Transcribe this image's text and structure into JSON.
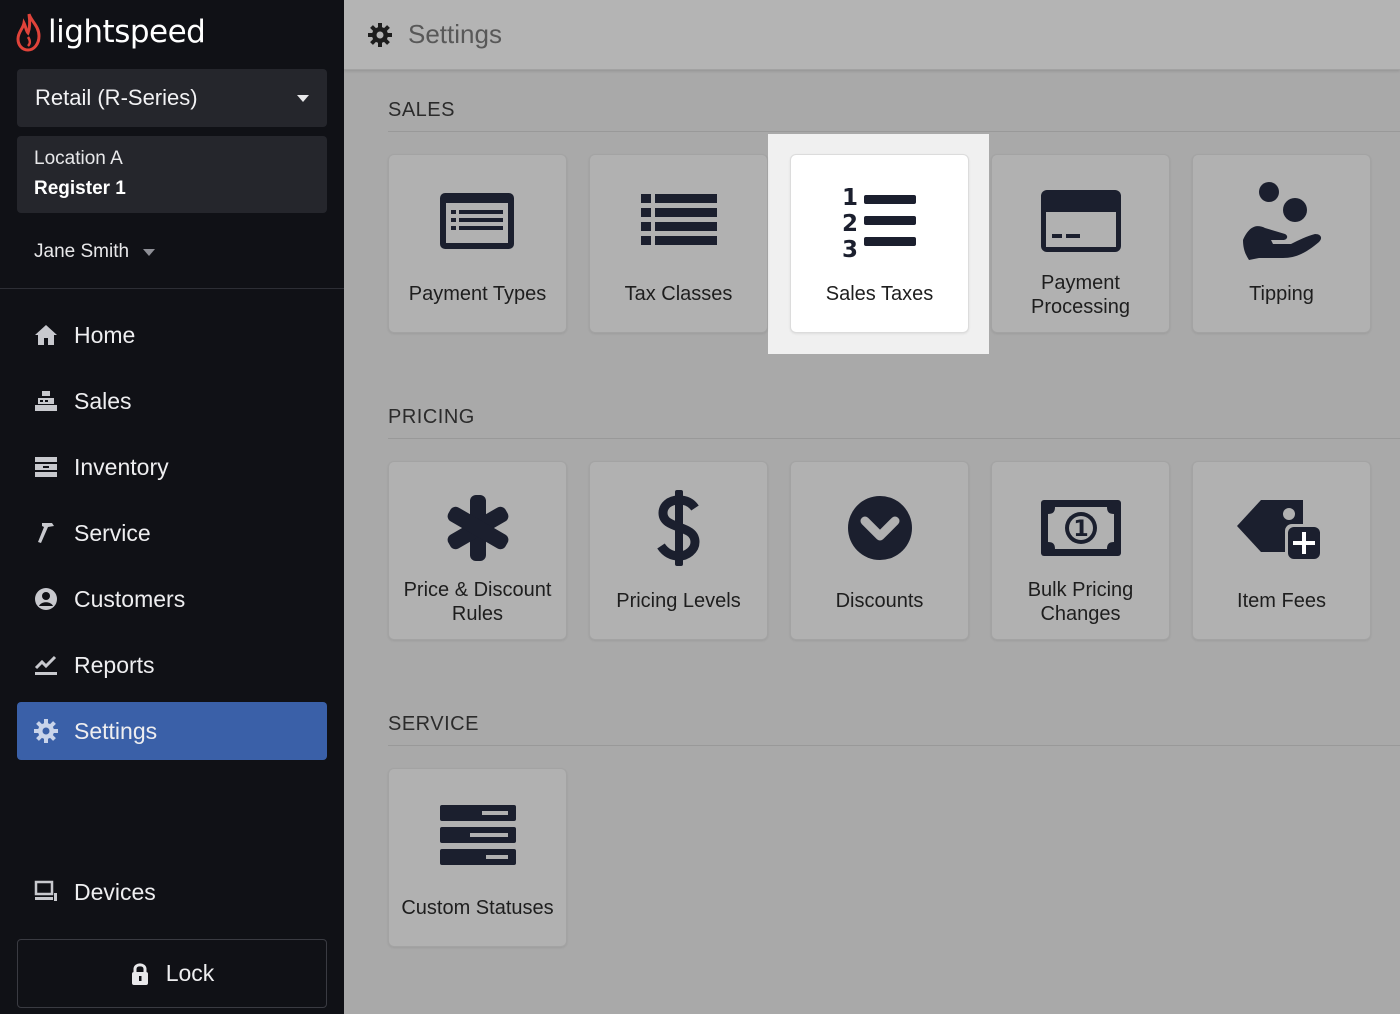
{
  "brand": {
    "logo_text": "lightspeed",
    "accent": "#e0433a"
  },
  "sidebar": {
    "product": "Retail (R-Series)",
    "location": "Location A",
    "register": "Register 1",
    "user": "Jane Smith",
    "nav": [
      {
        "label": "Home",
        "icon": "home-icon"
      },
      {
        "label": "Sales",
        "icon": "register-icon"
      },
      {
        "label": "Inventory",
        "icon": "inventory-icon"
      },
      {
        "label": "Service",
        "icon": "hammer-icon"
      },
      {
        "label": "Customers",
        "icon": "user-circle-icon"
      },
      {
        "label": "Reports",
        "icon": "chart-icon"
      },
      {
        "label": "Settings",
        "icon": "gear-icon",
        "active": true
      }
    ],
    "devices": "Devices",
    "lock": "Lock",
    "active_color": "#3a60a8"
  },
  "header": {
    "title": "Settings"
  },
  "sections": {
    "sales": {
      "title": "SALES",
      "tiles": [
        {
          "label": "Payment Types",
          "icon": "payment-types-icon"
        },
        {
          "label": "Tax Classes",
          "icon": "list-icon"
        },
        {
          "label": "Sales Taxes",
          "icon": "numbered-list-icon",
          "highlighted": true
        },
        {
          "label": "Payment Processing",
          "icon": "credit-card-icon"
        },
        {
          "label": "Tipping",
          "icon": "hand-coins-icon"
        }
      ]
    },
    "pricing": {
      "title": "PRICING",
      "tiles": [
        {
          "label": "Price & Discount Rules",
          "icon": "asterisk-icon"
        },
        {
          "label": "Pricing Levels",
          "icon": "dollar-icon"
        },
        {
          "label": "Discounts",
          "icon": "chevron-circle-icon"
        },
        {
          "label": "Bulk Pricing Changes",
          "icon": "banknote-icon"
        },
        {
          "label": "Item Fees",
          "icon": "tag-plus-icon"
        }
      ]
    },
    "service": {
      "title": "SERVICE",
      "tiles": [
        {
          "label": "Custom Statuses",
          "icon": "stacked-status-icon"
        }
      ]
    }
  }
}
